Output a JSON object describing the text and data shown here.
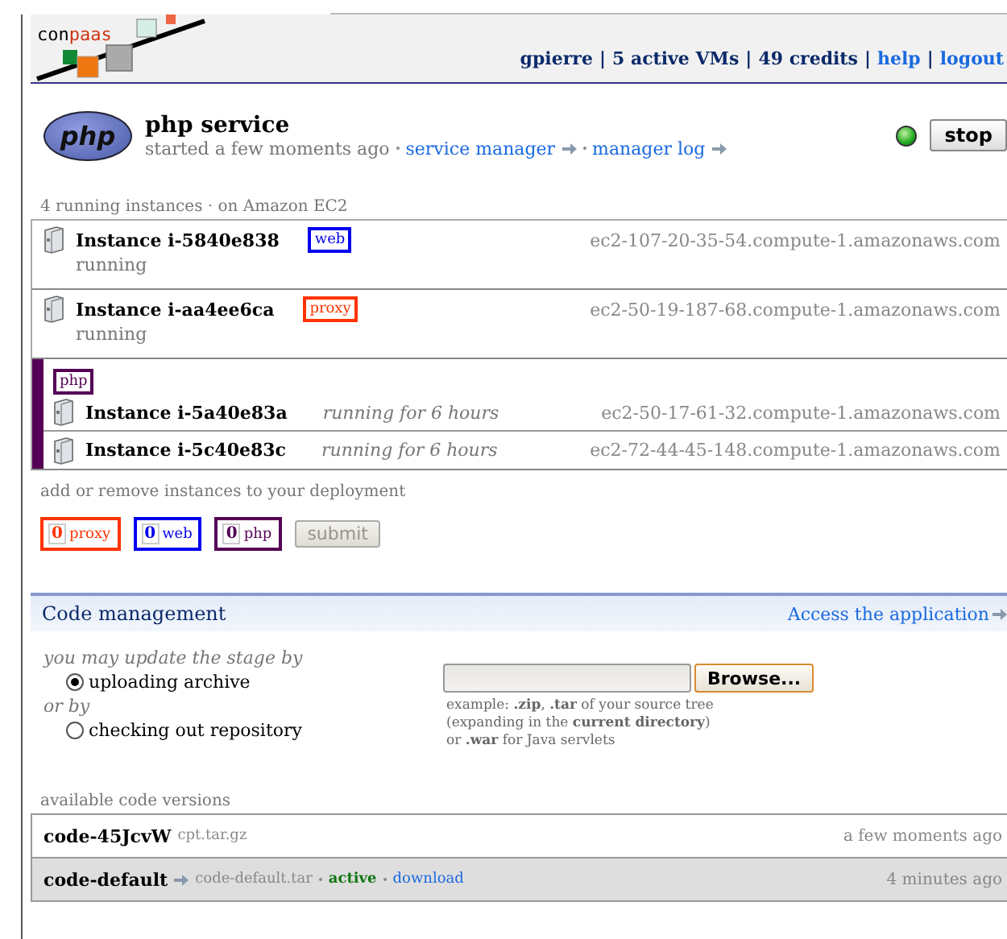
{
  "header": {
    "logo": {
      "prefix": "con",
      "suffix": "paas"
    },
    "user_bar": [
      {
        "kind": "info",
        "text": "gpierre"
      },
      {
        "kind": "sep",
        "text": "|"
      },
      {
        "kind": "info",
        "text": "5 active VMs"
      },
      {
        "kind": "sep",
        "text": "|"
      },
      {
        "kind": "info",
        "text": "49 credits"
      },
      {
        "kind": "sep",
        "text": "|"
      },
      {
        "kind": "link",
        "text": "help"
      },
      {
        "kind": "sep",
        "text": "|"
      },
      {
        "kind": "link",
        "text": "logout"
      }
    ]
  },
  "service": {
    "logo": "php",
    "name": "php service",
    "started": "started a few moments ago",
    "links": [
      "service manager",
      "manager log"
    ],
    "running": true,
    "stop_button": "stop"
  },
  "instances": {
    "caption": "4 running instances · on Amazon EC2",
    "groups": [
      {
        "kind": "single",
        "role": "web",
        "color": "#0000ee",
        "instances": [
          {
            "name": "Instance i-5840e838",
            "status": "running",
            "host": "ec2-107-20-35-54.compute-1.amazonaws.com"
          }
        ]
      },
      {
        "kind": "single",
        "role": "proxy",
        "color": "#ff3300",
        "instances": [
          {
            "name": "Instance i-aa4ee6ca",
            "status": "running",
            "host": "ec2-50-19-187-68.compute-1.amazonaws.com"
          }
        ]
      },
      {
        "kind": "group",
        "role": "php",
        "color": "#550055",
        "instances": [
          {
            "name": "Instance i-5a40e83a",
            "status": "running for 6 hours",
            "host": "ec2-50-17-61-32.compute-1.amazonaws.com"
          },
          {
            "name": "Instance i-5c40e83c",
            "status": "running for 6 hours",
            "host": "ec2-72-44-45-148.compute-1.amazonaws.com"
          }
        ]
      }
    ]
  },
  "deployment": {
    "caption": "add or remove instances to your deployment",
    "counters": [
      {
        "count": "0",
        "role": "proxy",
        "color": "#ff3300"
      },
      {
        "count": "0",
        "role": "web",
        "color": "#0000ee"
      },
      {
        "count": "0",
        "role": "php",
        "color": "#550055"
      }
    ],
    "submit": {
      "label": "submit",
      "disabled": true
    }
  },
  "code_management": {
    "title": "Code management",
    "link": "Access the application",
    "stage_caption": "you may update the stage by",
    "or_caption": "or by",
    "options": [
      {
        "label": "uploading archive",
        "selected": true
      },
      {
        "label": "checking out repository",
        "selected": false
      }
    ],
    "browse_button": "Browse...",
    "hint": [
      "example: **.zip**, **.tar** of your source tree",
      "(expanding in the **current directory**)",
      "or **.war** for Java servlets"
    ]
  },
  "versions": {
    "caption": "available code versions",
    "rows": [
      {
        "name": "code-45JcvW",
        "file": "cpt.tar.gz",
        "active": false,
        "time": "a few moments ago"
      },
      {
        "name": "code-default",
        "file": "code-default.tar",
        "active": true,
        "status": "active",
        "link": "download",
        "time": "4 minutes ago"
      }
    ]
  }
}
